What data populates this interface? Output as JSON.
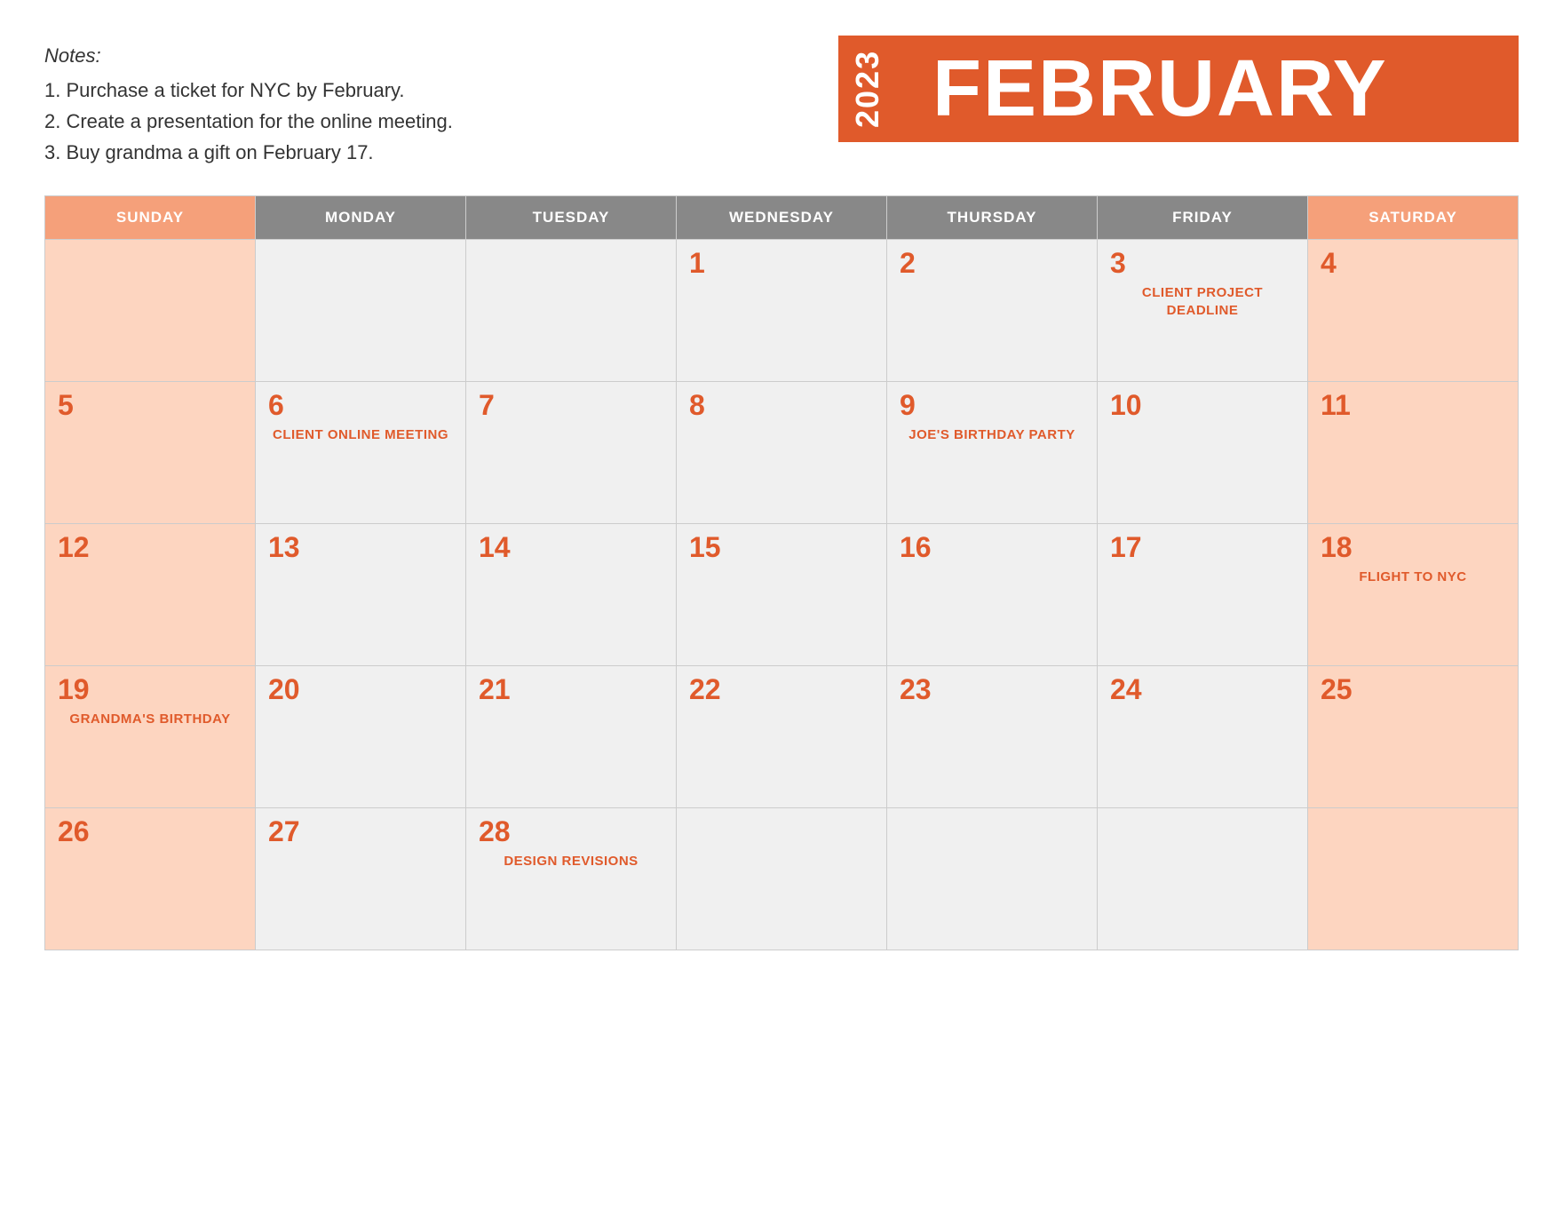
{
  "notes": {
    "title": "Notes:",
    "items": [
      "1. Purchase a ticket for NYC by February.",
      "2. Create a presentation for the online meeting.",
      "3. Buy grandma a gift on February 17."
    ]
  },
  "header": {
    "year": "2023",
    "month": "FEBRUARY"
  },
  "days_of_week": [
    {
      "label": "SUNDAY",
      "weekend": true
    },
    {
      "label": "MONDAY",
      "weekend": false
    },
    {
      "label": "TUESDAY",
      "weekend": false
    },
    {
      "label": "WEDNESDAY",
      "weekend": false
    },
    {
      "label": "THURSDAY",
      "weekend": false
    },
    {
      "label": "FRIDAY",
      "weekend": false
    },
    {
      "label": "SATURDAY",
      "weekend": true
    }
  ],
  "weeks": [
    [
      {
        "day": "",
        "event": "",
        "weekend": true,
        "empty": true
      },
      {
        "day": "",
        "event": "",
        "weekend": false,
        "empty": true
      },
      {
        "day": "",
        "event": "",
        "weekend": false,
        "empty": true
      },
      {
        "day": "1",
        "event": "",
        "weekend": false
      },
      {
        "day": "2",
        "event": "",
        "weekend": false
      },
      {
        "day": "3",
        "event": "CLIENT PROJECT DEADLINE",
        "weekend": false
      },
      {
        "day": "4",
        "event": "",
        "weekend": true
      }
    ],
    [
      {
        "day": "5",
        "event": "",
        "weekend": true
      },
      {
        "day": "6",
        "event": "CLIENT ONLINE MEETING",
        "weekend": false
      },
      {
        "day": "7",
        "event": "",
        "weekend": false
      },
      {
        "day": "8",
        "event": "",
        "weekend": false
      },
      {
        "day": "9",
        "event": "JOE'S BIRTHDAY PARTY",
        "weekend": false
      },
      {
        "day": "10",
        "event": "",
        "weekend": false
      },
      {
        "day": "11",
        "event": "",
        "weekend": true
      }
    ],
    [
      {
        "day": "12",
        "event": "",
        "weekend": true
      },
      {
        "day": "13",
        "event": "",
        "weekend": false
      },
      {
        "day": "14",
        "event": "",
        "weekend": false
      },
      {
        "day": "15",
        "event": "",
        "weekend": false
      },
      {
        "day": "16",
        "event": "",
        "weekend": false
      },
      {
        "day": "17",
        "event": "",
        "weekend": false
      },
      {
        "day": "18",
        "event": "FLIGHT TO NYC",
        "weekend": true
      }
    ],
    [
      {
        "day": "19",
        "event": "GRANDMA'S BIRTHDAY",
        "weekend": true
      },
      {
        "day": "20",
        "event": "",
        "weekend": false
      },
      {
        "day": "21",
        "event": "",
        "weekend": false
      },
      {
        "day": "22",
        "event": "",
        "weekend": false
      },
      {
        "day": "23",
        "event": "",
        "weekend": false
      },
      {
        "day": "24",
        "event": "",
        "weekend": false
      },
      {
        "day": "25",
        "event": "",
        "weekend": true
      }
    ],
    [
      {
        "day": "26",
        "event": "",
        "weekend": true
      },
      {
        "day": "27",
        "event": "",
        "weekend": false
      },
      {
        "day": "28",
        "event": "DESIGN REVISIONS",
        "weekend": false
      },
      {
        "day": "",
        "event": "",
        "weekend": false,
        "empty": true
      },
      {
        "day": "",
        "event": "",
        "weekend": false,
        "empty": true
      },
      {
        "day": "",
        "event": "",
        "weekend": false,
        "empty": true
      },
      {
        "day": "",
        "event": "",
        "weekend": true,
        "empty": true
      }
    ]
  ]
}
